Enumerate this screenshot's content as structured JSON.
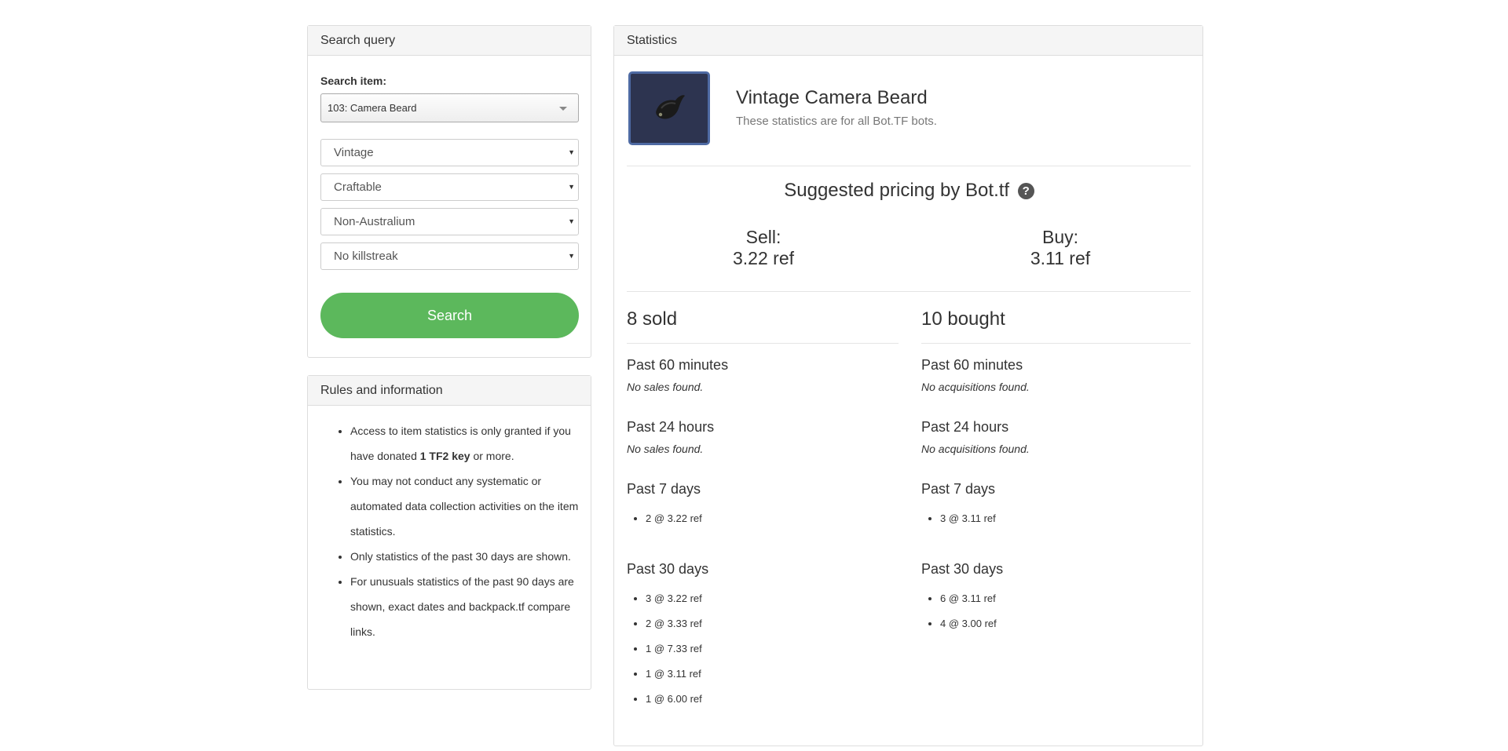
{
  "search_panel": {
    "heading": "Search query",
    "search_label": "Search item:",
    "item_select_value": "103: Camera Beard",
    "quality_value": "Vintage",
    "craftable_value": "Craftable",
    "australium_value": "Non-Australium",
    "killstreak_value": "No killstreak",
    "search_button_label": "Search",
    "dropdown_arrow": "▼"
  },
  "rules_panel": {
    "heading": "Rules and information",
    "rule1_pre": "Access to item statistics is only granted if you have donated ",
    "rule1_bold": "1 TF2 key",
    "rule1_post": " or more.",
    "rule2": "You may not conduct any systematic or automated data collection activities on the item statistics.",
    "rule3": "Only statistics of the past 30 days are shown.",
    "rule4": "For unusuals statistics of the past 90 days are shown, exact dates and backpack.tf compare links."
  },
  "stats_panel": {
    "heading": "Statistics",
    "item_name": "Vintage Camera Beard",
    "item_subtitle": "These statistics are for all Bot.TF bots.",
    "item_image_icon": "camera-beard-icon",
    "pricing_heading": "Suggested pricing by Bot.tf",
    "help_icon_glyph": "?",
    "sell_label": "Sell:",
    "sell_price": "3.22 ref",
    "buy_label": "Buy:",
    "buy_price": "3.11 ref",
    "sold": {
      "heading": "8 sold",
      "past_60_label": "Past 60 minutes",
      "past_60_note": "No sales found.",
      "past_24_label": "Past 24 hours",
      "past_24_note": "No sales found.",
      "past_7_label": "Past 7 days",
      "past_7_items": [
        "2 @ 3.22 ref"
      ],
      "past_30_label": "Past 30 days",
      "past_30_items": [
        "3 @ 3.22 ref",
        "2 @ 3.33 ref",
        "1 @ 7.33 ref",
        "1 @ 3.11 ref",
        "1 @ 6.00 ref"
      ]
    },
    "bought": {
      "heading": "10 bought",
      "past_60_label": "Past 60 minutes",
      "past_60_note": "No acquisitions found.",
      "past_24_label": "Past 24 hours",
      "past_24_note": "No acquisitions found.",
      "past_7_label": "Past 7 days",
      "past_7_items": [
        "3 @ 3.11 ref"
      ],
      "past_30_label": "Past 30 days",
      "past_30_items": [
        "6 @ 3.11 ref",
        "4 @ 3.00 ref"
      ]
    }
  }
}
